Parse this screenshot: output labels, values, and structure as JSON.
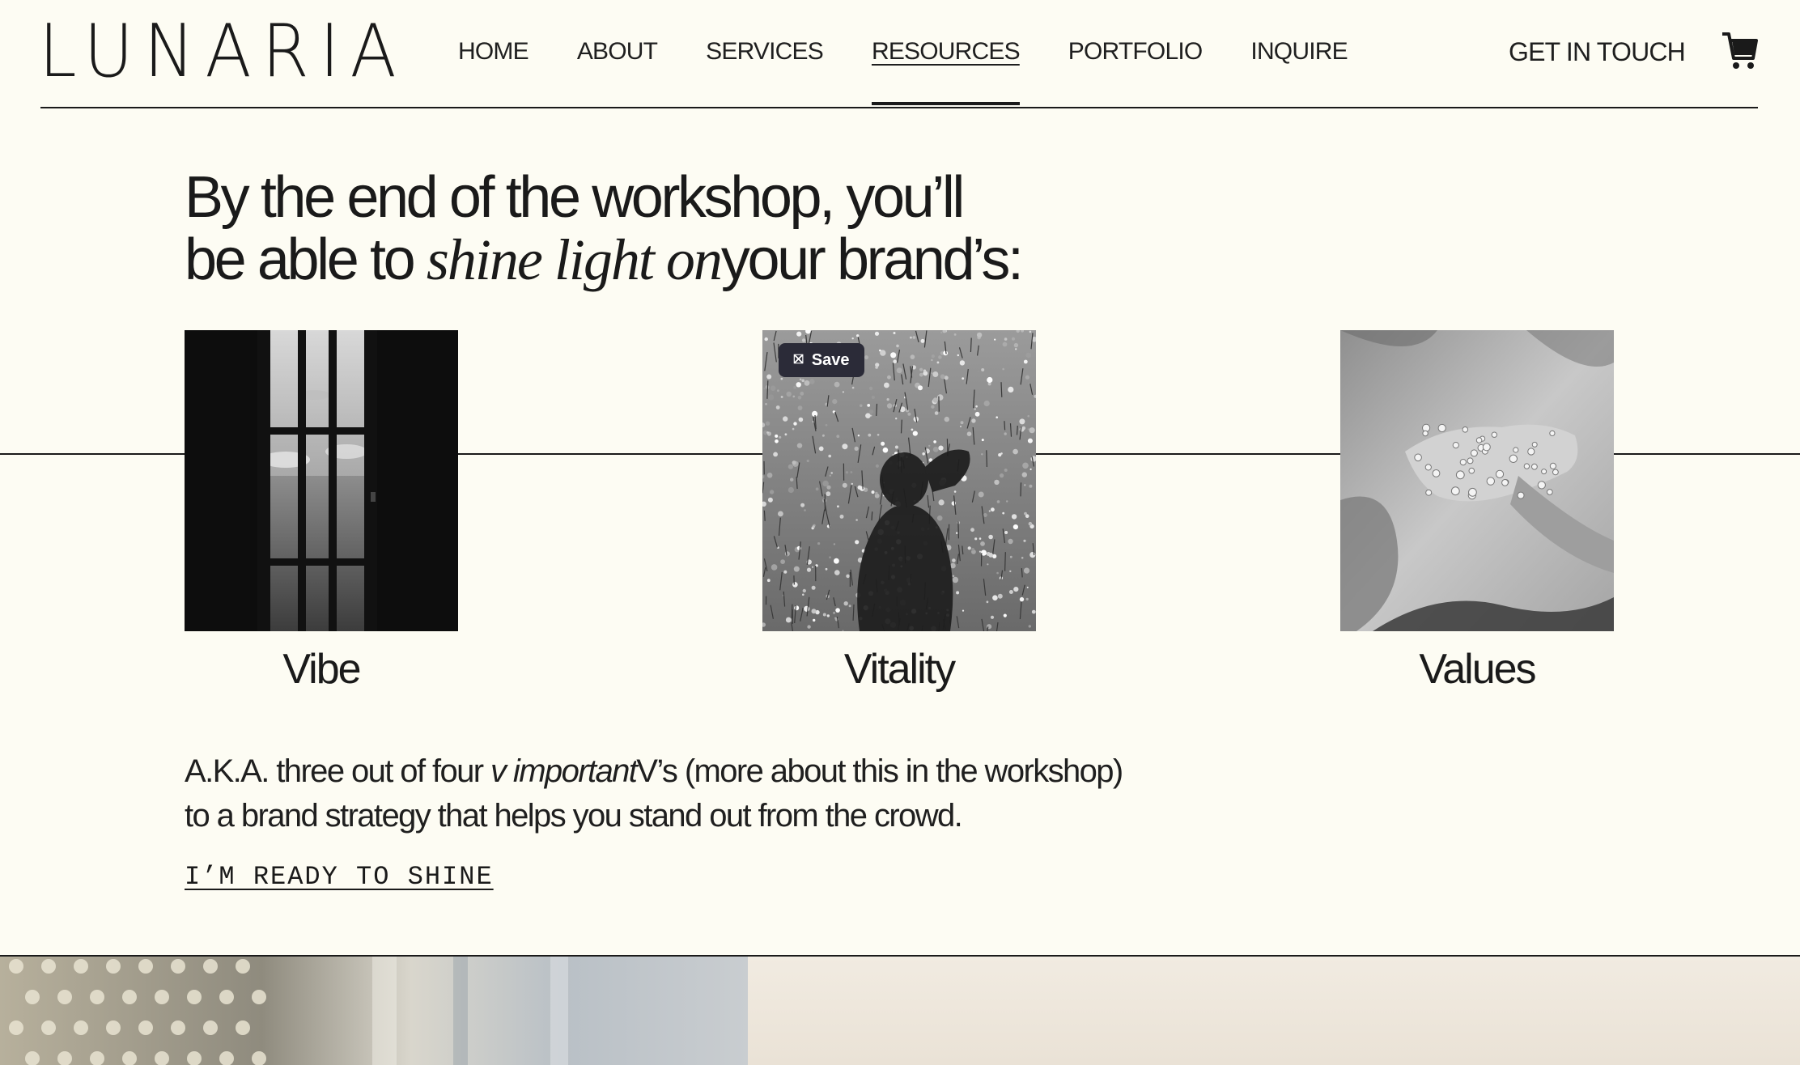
{
  "brand": {
    "logo_text": "LUNARIA"
  },
  "nav": {
    "items": [
      {
        "label": "HOME"
      },
      {
        "label": "ABOUT"
      },
      {
        "label": "SERVICES"
      },
      {
        "label": "RESOURCES",
        "active": true
      },
      {
        "label": "PORTFOLIO"
      },
      {
        "label": "INQUIRE"
      }
    ],
    "cta_label": "GET IN TOUCH",
    "cart_icon": "cart-icon"
  },
  "headline": {
    "line1": "By the end of the workshop, you’ll",
    "line2_start": "be able to ",
    "line2_emphasis": "shine light on",
    "line2_end": "your brand’s:"
  },
  "cards": [
    {
      "caption": "Vibe",
      "image": "window-sea-photo"
    },
    {
      "caption": "Vitality",
      "image": "shadow-in-flowers-photo",
      "save_label": "Save",
      "save_icon": "pinterest-save-icon"
    },
    {
      "caption": "Values",
      "image": "pearl-hand-photo"
    }
  ],
  "body": {
    "text_start": "A.K.A. three out of four ",
    "text_emphasis": "v important",
    "text_end": "V’s (more about this in the workshop) to a brand strategy that helps you stand out from the crowd.",
    "cta_label": "I’M READY TO SHINE"
  },
  "colors": {
    "background": "#fdfcf3",
    "text": "#1a1a1a",
    "save_button": "#2b2b38",
    "bottom_panel": "#efe8de"
  }
}
